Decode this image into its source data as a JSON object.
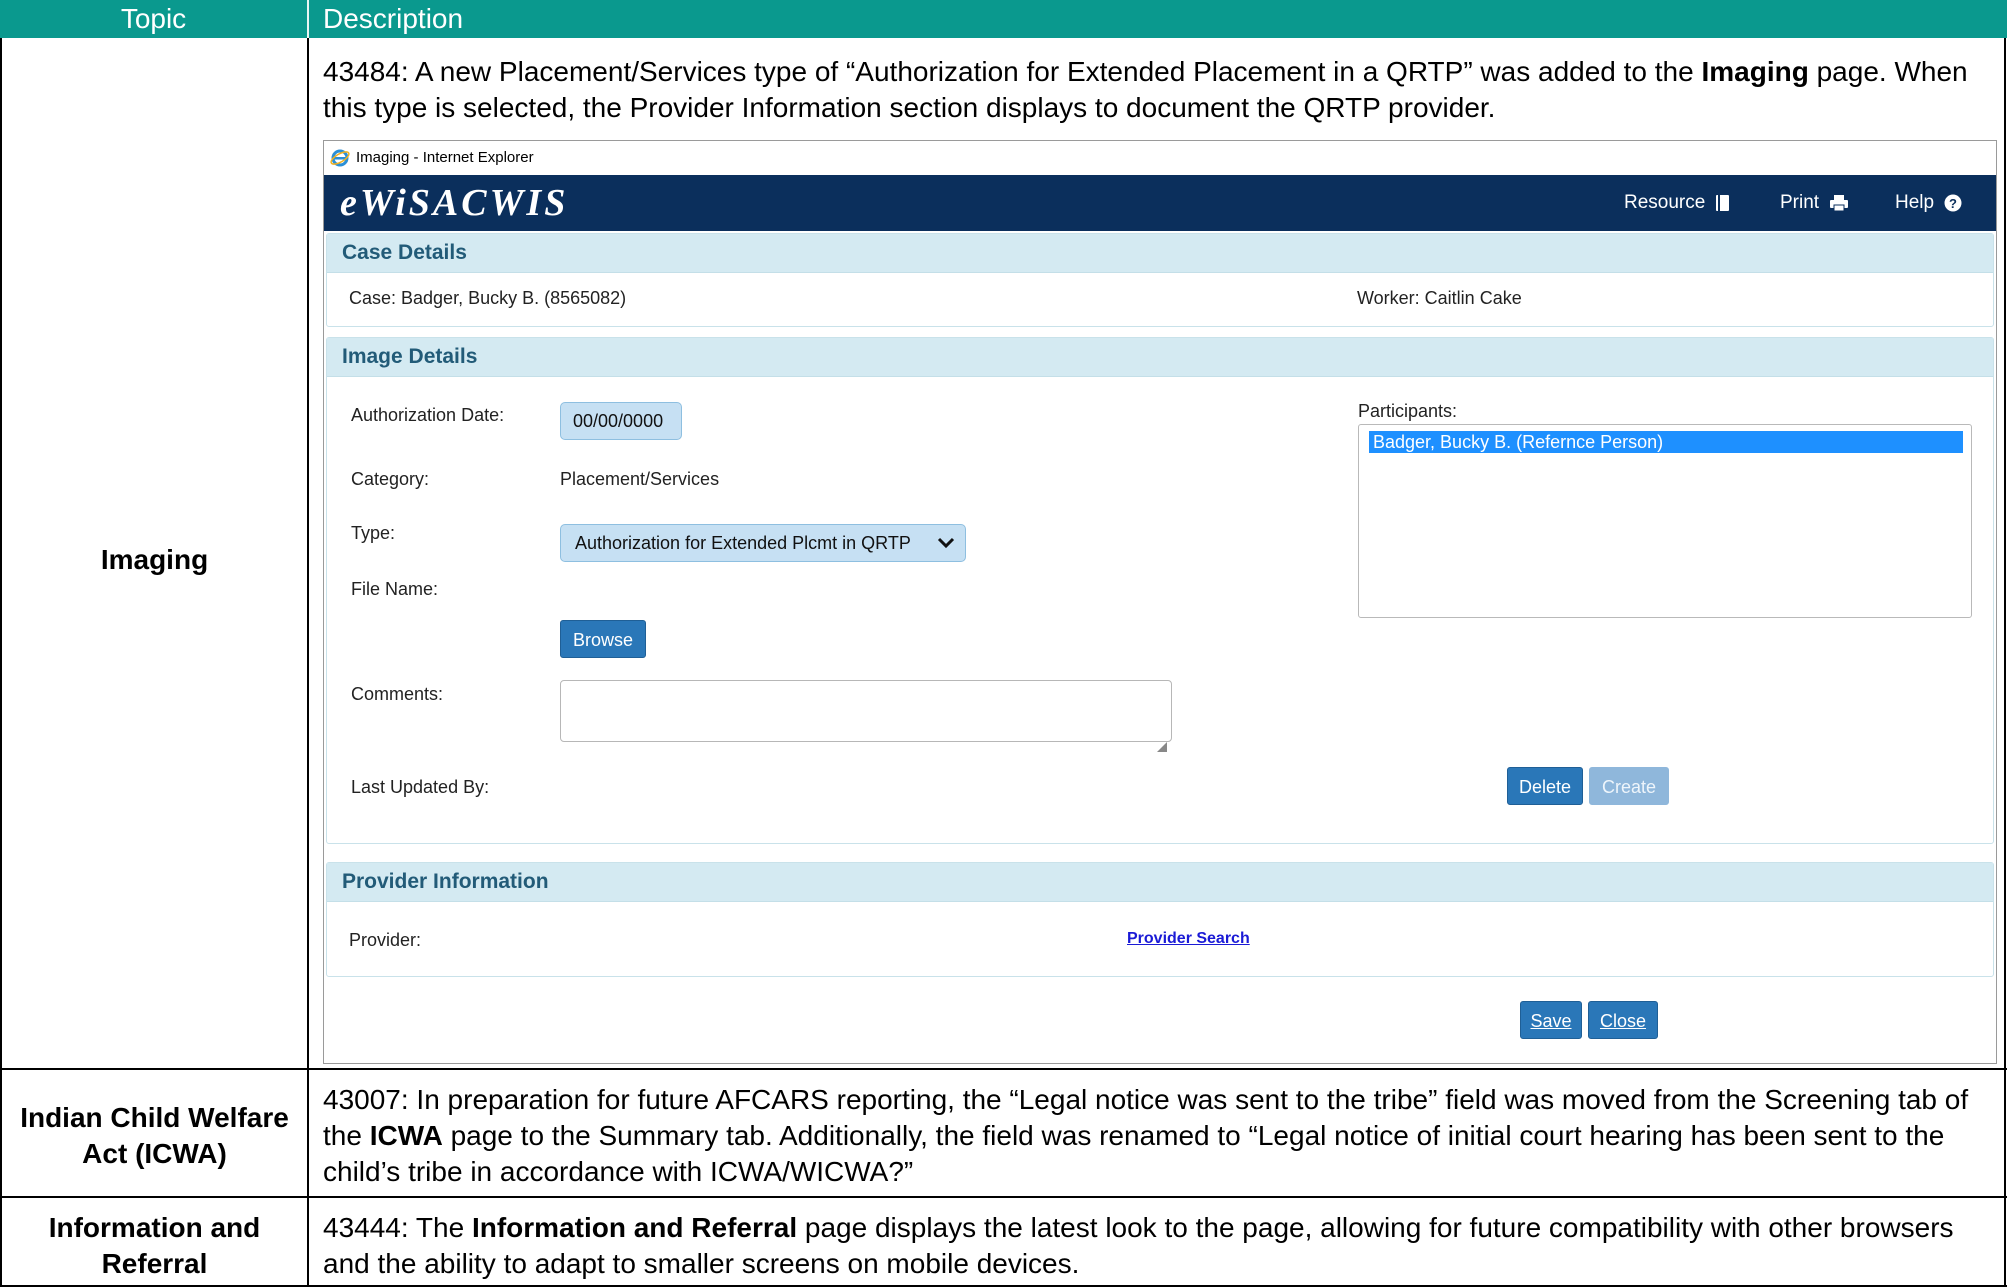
{
  "table": {
    "header": {
      "topic": "Topic",
      "description": "Description"
    },
    "rows": [
      {
        "topic": "Imaging",
        "description_parts": [
          "43484: A new Placement/Services type of “Authorization for Extended Placement in a QRTP” was added to the ",
          "Imaging",
          " page. When this type is selected, the Provider Information section displays to document the QRTP provider."
        ]
      },
      {
        "topic": "Indian Child Welfare Act (ICWA)",
        "description_parts": [
          "43007: In preparation for future AFCARS reporting, the “Legal notice was sent to the tribe” field was moved from the Screening tab of the ",
          "ICWA",
          " page to the Summary tab. Additionally, the field was renamed to “Legal notice of initial court hearing has been sent to the child’s tribe in accordance with ICWA/WICWA?”"
        ]
      },
      {
        "topic": "Information and Referral",
        "description_parts": [
          "43444: The ",
          "Information and Referral",
          " page displays the latest look to the page, allowing for future compatibility with other browsers and the ability to adapt to smaller screens on mobile devices."
        ]
      }
    ]
  },
  "screenshot": {
    "window_title": "Imaging - Internet Explorer",
    "app_name": "eWiSACWIS",
    "banner_links": {
      "resource": "Resource",
      "print": "Print",
      "help": "Help"
    },
    "case_details": {
      "heading": "Case Details",
      "case": "Case: Badger, Bucky B. (8565082)",
      "worker": "Worker: Caitlin Cake"
    },
    "image_details": {
      "heading": "Image Details",
      "authorization_date_label": "Authorization Date:",
      "authorization_date_value": "00/00/0000",
      "category_label": "Category:",
      "category_value": "Placement/Services",
      "type_label": "Type:",
      "type_value": "Authorization for Extended Plcmt in QRTP",
      "file_name_label": "File Name:",
      "browse_label": "Browse",
      "comments_label": "Comments:",
      "last_updated_label": "Last Updated By:",
      "participants_label": "Participants:",
      "participants": [
        "Badger, Bucky B. (Refernce Person)"
      ],
      "delete_label": "Delete",
      "create_label": "Create"
    },
    "provider_information": {
      "heading": "Provider Information",
      "provider_label": "Provider:",
      "provider_search_label": "Provider Search"
    },
    "save_label": "Save",
    "close_label": "Close"
  }
}
